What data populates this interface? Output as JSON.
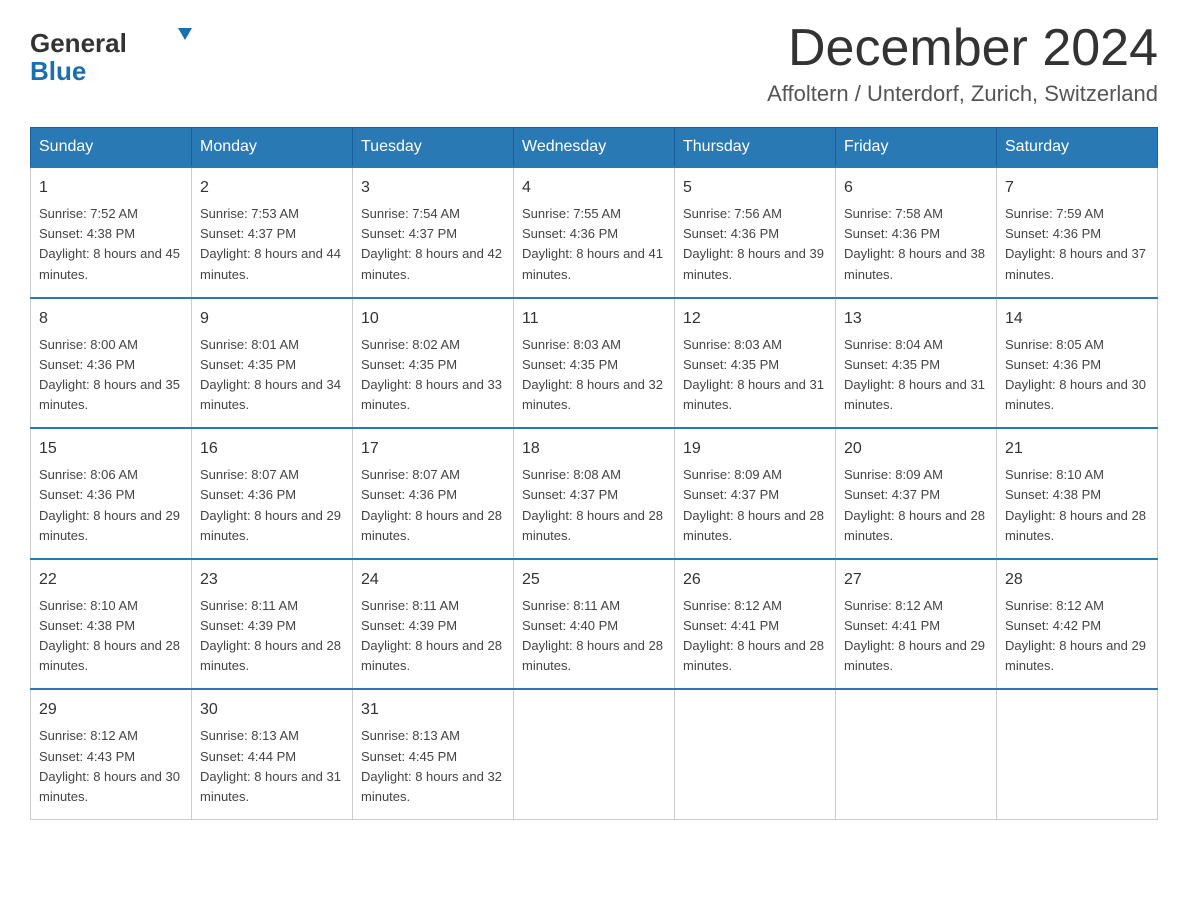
{
  "logo": {
    "general": "General",
    "blue": "Blue"
  },
  "title": {
    "month_year": "December 2024",
    "location": "Affoltern / Unterdorf, Zurich, Switzerland"
  },
  "headers": [
    "Sunday",
    "Monday",
    "Tuesday",
    "Wednesday",
    "Thursday",
    "Friday",
    "Saturday"
  ],
  "weeks": [
    [
      {
        "day": "1",
        "sunrise": "7:52 AM",
        "sunset": "4:38 PM",
        "daylight": "8 hours and 45 minutes."
      },
      {
        "day": "2",
        "sunrise": "7:53 AM",
        "sunset": "4:37 PM",
        "daylight": "8 hours and 44 minutes."
      },
      {
        "day": "3",
        "sunrise": "7:54 AM",
        "sunset": "4:37 PM",
        "daylight": "8 hours and 42 minutes."
      },
      {
        "day": "4",
        "sunrise": "7:55 AM",
        "sunset": "4:36 PM",
        "daylight": "8 hours and 41 minutes."
      },
      {
        "day": "5",
        "sunrise": "7:56 AM",
        "sunset": "4:36 PM",
        "daylight": "8 hours and 39 minutes."
      },
      {
        "day": "6",
        "sunrise": "7:58 AM",
        "sunset": "4:36 PM",
        "daylight": "8 hours and 38 minutes."
      },
      {
        "day": "7",
        "sunrise": "7:59 AM",
        "sunset": "4:36 PM",
        "daylight": "8 hours and 37 minutes."
      }
    ],
    [
      {
        "day": "8",
        "sunrise": "8:00 AM",
        "sunset": "4:36 PM",
        "daylight": "8 hours and 35 minutes."
      },
      {
        "day": "9",
        "sunrise": "8:01 AM",
        "sunset": "4:35 PM",
        "daylight": "8 hours and 34 minutes."
      },
      {
        "day": "10",
        "sunrise": "8:02 AM",
        "sunset": "4:35 PM",
        "daylight": "8 hours and 33 minutes."
      },
      {
        "day": "11",
        "sunrise": "8:03 AM",
        "sunset": "4:35 PM",
        "daylight": "8 hours and 32 minutes."
      },
      {
        "day": "12",
        "sunrise": "8:03 AM",
        "sunset": "4:35 PM",
        "daylight": "8 hours and 31 minutes."
      },
      {
        "day": "13",
        "sunrise": "8:04 AM",
        "sunset": "4:35 PM",
        "daylight": "8 hours and 31 minutes."
      },
      {
        "day": "14",
        "sunrise": "8:05 AM",
        "sunset": "4:36 PM",
        "daylight": "8 hours and 30 minutes."
      }
    ],
    [
      {
        "day": "15",
        "sunrise": "8:06 AM",
        "sunset": "4:36 PM",
        "daylight": "8 hours and 29 minutes."
      },
      {
        "day": "16",
        "sunrise": "8:07 AM",
        "sunset": "4:36 PM",
        "daylight": "8 hours and 29 minutes."
      },
      {
        "day": "17",
        "sunrise": "8:07 AM",
        "sunset": "4:36 PM",
        "daylight": "8 hours and 28 minutes."
      },
      {
        "day": "18",
        "sunrise": "8:08 AM",
        "sunset": "4:37 PM",
        "daylight": "8 hours and 28 minutes."
      },
      {
        "day": "19",
        "sunrise": "8:09 AM",
        "sunset": "4:37 PM",
        "daylight": "8 hours and 28 minutes."
      },
      {
        "day": "20",
        "sunrise": "8:09 AM",
        "sunset": "4:37 PM",
        "daylight": "8 hours and 28 minutes."
      },
      {
        "day": "21",
        "sunrise": "8:10 AM",
        "sunset": "4:38 PM",
        "daylight": "8 hours and 28 minutes."
      }
    ],
    [
      {
        "day": "22",
        "sunrise": "8:10 AM",
        "sunset": "4:38 PM",
        "daylight": "8 hours and 28 minutes."
      },
      {
        "day": "23",
        "sunrise": "8:11 AM",
        "sunset": "4:39 PM",
        "daylight": "8 hours and 28 minutes."
      },
      {
        "day": "24",
        "sunrise": "8:11 AM",
        "sunset": "4:39 PM",
        "daylight": "8 hours and 28 minutes."
      },
      {
        "day": "25",
        "sunrise": "8:11 AM",
        "sunset": "4:40 PM",
        "daylight": "8 hours and 28 minutes."
      },
      {
        "day": "26",
        "sunrise": "8:12 AM",
        "sunset": "4:41 PM",
        "daylight": "8 hours and 28 minutes."
      },
      {
        "day": "27",
        "sunrise": "8:12 AM",
        "sunset": "4:41 PM",
        "daylight": "8 hours and 29 minutes."
      },
      {
        "day": "28",
        "sunrise": "8:12 AM",
        "sunset": "4:42 PM",
        "daylight": "8 hours and 29 minutes."
      }
    ],
    [
      {
        "day": "29",
        "sunrise": "8:12 AM",
        "sunset": "4:43 PM",
        "daylight": "8 hours and 30 minutes."
      },
      {
        "day": "30",
        "sunrise": "8:13 AM",
        "sunset": "4:44 PM",
        "daylight": "8 hours and 31 minutes."
      },
      {
        "day": "31",
        "sunrise": "8:13 AM",
        "sunset": "4:45 PM",
        "daylight": "8 hours and 32 minutes."
      },
      null,
      null,
      null,
      null
    ]
  ]
}
